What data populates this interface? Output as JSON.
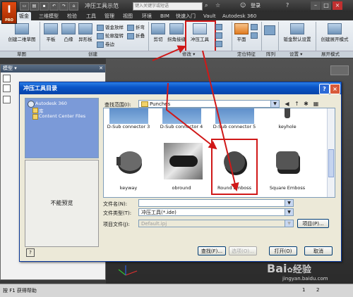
{
  "app": {
    "logo_letter": "I",
    "logo_sub": "PRO",
    "window_title": "冲压工具示范",
    "search_placeholder": "键入关键字或短语",
    "login": "登录",
    "win_min": "–",
    "win_max": "□",
    "win_close": "×"
  },
  "tabs": [
    "钣金",
    "三维模型",
    "检验",
    "工具",
    "管理",
    "视图",
    "环境",
    "BIM",
    "快速入门",
    "Vault",
    "Autodesk 360"
  ],
  "ribbon": {
    "sketch_btn": "创建二维草图",
    "sheet": [
      "平板",
      "凸缘",
      "异形板"
    ],
    "small_col1": [
      "钣金放样",
      "轮廓旋转",
      "卷边"
    ],
    "small_col2": [
      "折弯",
      "折叠"
    ],
    "cut": "剪切",
    "corner": "拐角接缝",
    "punch": "冲压工具",
    "plane": "平面",
    "settings": "钣金默认设置",
    "flat": "创建展开模式",
    "panels": [
      "草图",
      "创建",
      "修改 ▾",
      "定位特征",
      "阵列",
      "设置 ▾",
      "展开模式"
    ]
  },
  "model_panel": {
    "title": "模型 ▾",
    "pin": "✕"
  },
  "status": {
    "text": "按 F1 获得帮助",
    "num1": "1",
    "num2": "2"
  },
  "dialog": {
    "title": "冲压工具目录",
    "help_btn": "?",
    "close_btn": "×",
    "places": [
      "Autodesk 360",
      "库",
      "Content Center Files"
    ],
    "lookin_label": "查找范围(I):",
    "lookin_value": "Punches",
    "preview_text": "不能预览",
    "files": [
      {
        "name": "D-Sub connector 3",
        "shape": "dsub"
      },
      {
        "name": "D-Sub connector 4",
        "shape": "dsub"
      },
      {
        "name": "D-Sub connector 5",
        "shape": "dsub"
      },
      {
        "name": "keyhole",
        "shape": "keyhole"
      },
      {
        "name": "keyway",
        "shape": "keyway"
      },
      {
        "name": "obround",
        "shape": "obround"
      },
      {
        "name": "Round Emboss",
        "shape": "round"
      },
      {
        "name": "Square Emboss",
        "shape": "square"
      }
    ],
    "filename_label": "文件名(N):",
    "filename_value": "",
    "filetype_label": "文件类型(T):",
    "filetype_value": "冲压工具(*.ide)",
    "project_label": "项目文件(J):",
    "project_value": "Default.ipj",
    "project_btn": "项目(P)...",
    "find_btn": "查找(F)...",
    "options_btn": "选项(O)...",
    "open_btn": "打开(O)",
    "cancel_btn": "取消"
  },
  "watermark": {
    "brand": "Bai",
    "brand2": "经验",
    "url": "jingyan.baidu.com"
  },
  "colors": {
    "highlight_red": "#d01818",
    "dialog_blue": "#0a55c8",
    "places_blue": "#7b9ad8"
  }
}
